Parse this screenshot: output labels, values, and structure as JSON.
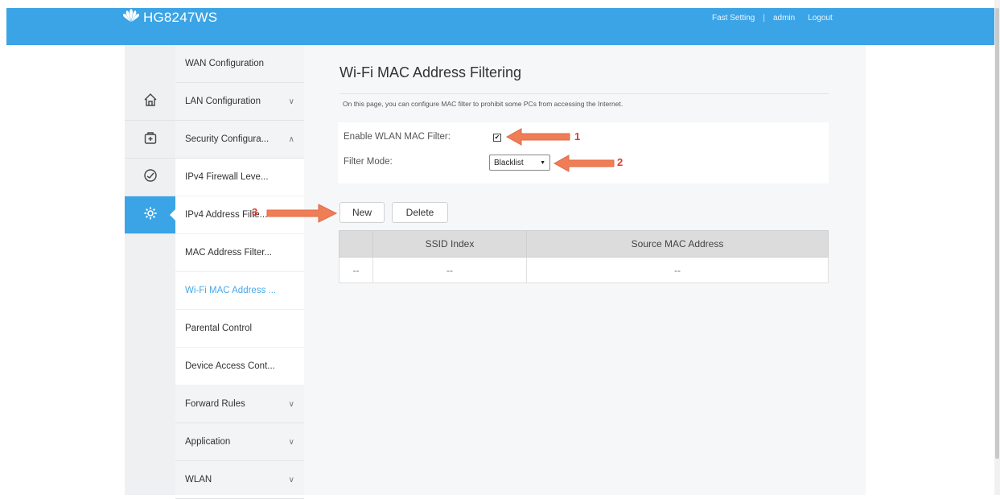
{
  "header": {
    "product_name": "HG8247WS",
    "links": [
      "Fast Setting",
      "admin",
      "Logout"
    ],
    "separator": "|"
  },
  "colors": {
    "accent": "#3ba4e6",
    "annotation_arrow": "#ef7d56",
    "annotation_number": "#e03a2a"
  },
  "icon_sidebar": [
    {
      "icon": "home-icon",
      "active": false
    },
    {
      "icon": "toolbox-icon",
      "active": false
    },
    {
      "icon": "speedometer-icon",
      "active": false
    },
    {
      "icon": "gear-icon",
      "active": true
    }
  ],
  "nav": {
    "items": [
      {
        "label": "WAN Configuration",
        "chevron": ""
      },
      {
        "label": "LAN Configuration",
        "chevron": "∨"
      },
      {
        "label": "Security Configura...",
        "chevron": "∧"
      },
      {
        "label": "IPv4 Firewall Leve...",
        "chevron": ""
      },
      {
        "label": "IPv4 Address Filte...",
        "chevron": ""
      },
      {
        "label": "MAC Address Filter...",
        "chevron": ""
      },
      {
        "label": "Wi-Fi MAC Address ...",
        "chevron": ""
      },
      {
        "label": "Parental Control",
        "chevron": ""
      },
      {
        "label": "Device Access Cont...",
        "chevron": ""
      },
      {
        "label": "Forward Rules",
        "chevron": "∨"
      },
      {
        "label": "Application",
        "chevron": "∨"
      },
      {
        "label": "WLAN",
        "chevron": "∨"
      }
    ]
  },
  "main": {
    "title": "Wi-Fi MAC Address Filtering",
    "description": "On this page, you can configure MAC filter to prohibit some PCs from accessing the Internet.",
    "enable_label": "Enable WLAN MAC Filter:",
    "enable_checked_mark": "✔",
    "filter_mode_label": "Filter Mode:",
    "filter_mode_value": "Blacklist",
    "select_arrow": "▼",
    "buttons": {
      "new": "New",
      "delete": "Delete"
    },
    "table": {
      "headers": [
        "",
        "SSID Index",
        "Source MAC Address"
      ],
      "rows": [
        [
          "--",
          "--",
          "--"
        ]
      ]
    }
  },
  "annotations": [
    "1",
    "2",
    "3"
  ]
}
